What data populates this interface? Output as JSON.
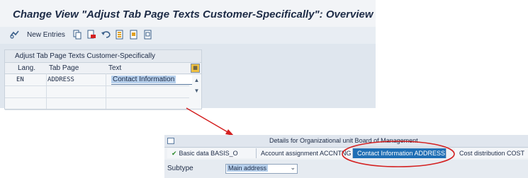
{
  "top_window": {
    "title": "Change View \"Adjust Tab Page Texts Customer-Specifically\": Overview",
    "toolbar": {
      "new_entries_label": "New Entries"
    },
    "table": {
      "title": "Adjust Tab Page Texts Customer-Specifically",
      "columns": [
        "Lang.",
        "Tab Page",
        "Text"
      ],
      "rows": [
        {
          "lang": "EN",
          "tab_page": "ADDRESS",
          "text": "Contact Information"
        }
      ]
    }
  },
  "bottom_window": {
    "details_title": "Details for Organizational unit Board of Management",
    "tabs": [
      {
        "label": "Basic data BASIS_O",
        "active": false
      },
      {
        "label": "Account assignment ACCNTNG",
        "active": false
      },
      {
        "label": "Contact Information ADDRESS",
        "active": true
      },
      {
        "label": "Cost distribution COST",
        "active": false
      }
    ],
    "subtype_label": "Subtype",
    "subtype_value": "Main address"
  },
  "colors": {
    "title_text": "#1d2b46",
    "active_tab": "#1f6fb5",
    "annotation_red": "#d42020",
    "selection_highlight": "#b7d0ec"
  },
  "icons": [
    "glasses-icon",
    "copy-icon",
    "delete-icon",
    "undo-icon",
    "select-all-icon",
    "select-block-icon",
    "deselect-icon",
    "table-settings-icon",
    "check-icon"
  ]
}
